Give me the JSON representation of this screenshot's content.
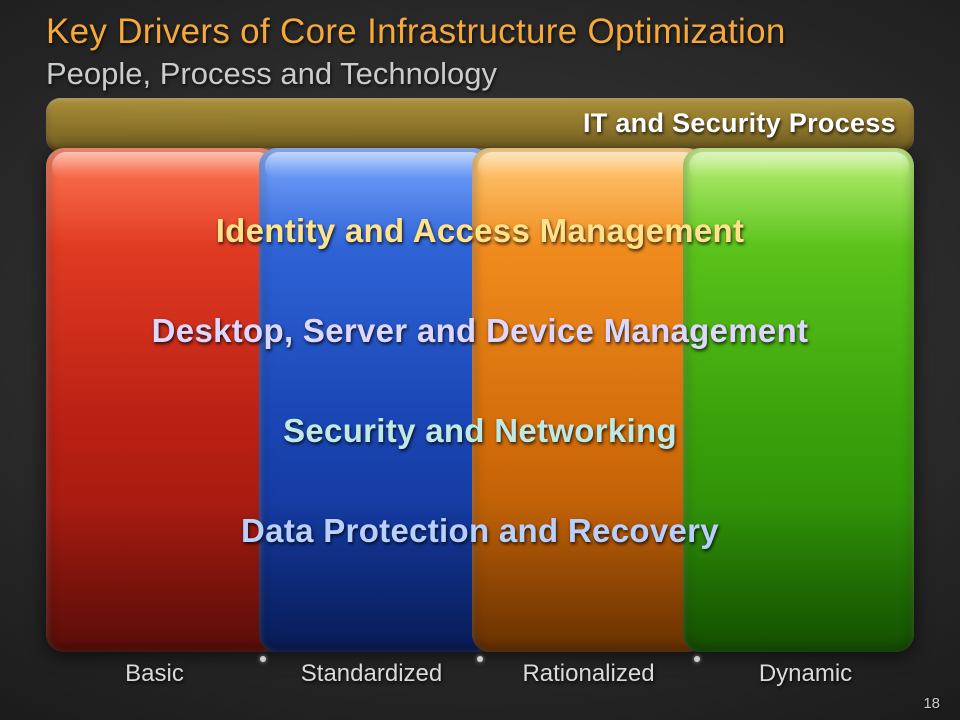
{
  "title": "Key Drivers of Core Infrastructure Optimization",
  "subtitle": "People, Process and Technology",
  "drivers": {
    "it_security_process": "IT and Security Process",
    "identity_access": "Identity and Access Management",
    "desktop_server_device": "Desktop, Server and Device Management",
    "security_networking": "Security and Networking",
    "data_protection_recovery": "Data Protection and Recovery"
  },
  "stages": {
    "basic": "Basic",
    "standardized": "Standardized",
    "rationalized": "Rationalized",
    "dynamic": "Dynamic"
  },
  "page_number": "18"
}
